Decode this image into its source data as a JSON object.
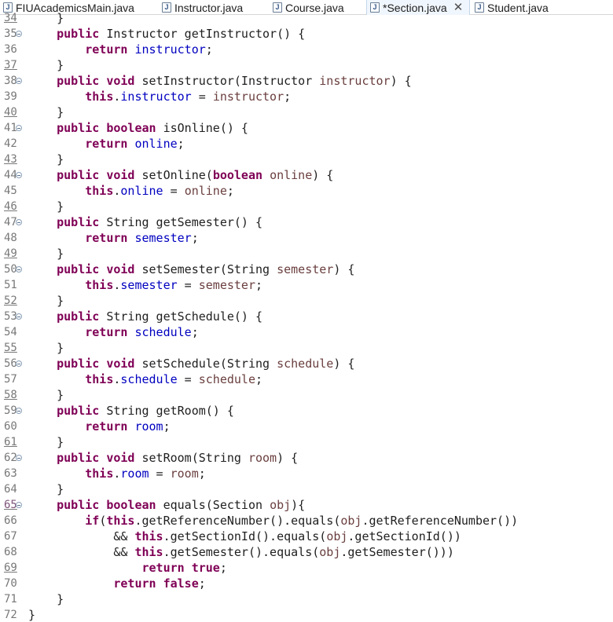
{
  "tabs": [
    {
      "label": "FIUAcademicsMain.java",
      "active": false,
      "closable": false
    },
    {
      "label": "Instructor.java",
      "active": false,
      "closable": false
    },
    {
      "label": "Course.java",
      "active": false,
      "closable": false
    },
    {
      "label": "*Section.java",
      "active": true,
      "closable": true
    },
    {
      "label": "Student.java",
      "active": false,
      "closable": false
    }
  ],
  "tab_close_glyph": "✕",
  "editor_lines": [
    {
      "num": "34",
      "underlined": true,
      "fold": false,
      "segments": [
        [
          "t",
          "    }"
        ]
      ]
    },
    {
      "num": "35",
      "underlined": false,
      "fold": true,
      "segments": [
        [
          "t",
          "    "
        ],
        [
          "k",
          "public"
        ],
        [
          "t",
          " Instructor getInstructor() {"
        ]
      ]
    },
    {
      "num": "36",
      "underlined": false,
      "fold": false,
      "segments": [
        [
          "t",
          "        "
        ],
        [
          "k",
          "return"
        ],
        [
          "t",
          " "
        ],
        [
          "f",
          "instructor"
        ],
        [
          "t",
          ";"
        ]
      ]
    },
    {
      "num": "37",
      "underlined": true,
      "fold": false,
      "segments": [
        [
          "t",
          "    }"
        ]
      ]
    },
    {
      "num": "38",
      "underlined": false,
      "fold": true,
      "segments": [
        [
          "t",
          "    "
        ],
        [
          "k",
          "public"
        ],
        [
          "t",
          " "
        ],
        [
          "k",
          "void"
        ],
        [
          "t",
          " setInstructor(Instructor "
        ],
        [
          "p",
          "instructor"
        ],
        [
          "t",
          ") {"
        ]
      ]
    },
    {
      "num": "39",
      "underlined": false,
      "fold": false,
      "segments": [
        [
          "t",
          "        "
        ],
        [
          "k",
          "this"
        ],
        [
          "t",
          "."
        ],
        [
          "f",
          "instructor"
        ],
        [
          "t",
          " = "
        ],
        [
          "p",
          "instructor"
        ],
        [
          "t",
          ";"
        ]
      ]
    },
    {
      "num": "40",
      "underlined": true,
      "fold": false,
      "segments": [
        [
          "t",
          "    }"
        ]
      ]
    },
    {
      "num": "41",
      "underlined": false,
      "fold": true,
      "segments": [
        [
          "t",
          "    "
        ],
        [
          "k",
          "public"
        ],
        [
          "t",
          " "
        ],
        [
          "k",
          "boolean"
        ],
        [
          "t",
          " isOnline() {"
        ]
      ]
    },
    {
      "num": "42",
      "underlined": false,
      "fold": false,
      "segments": [
        [
          "t",
          "        "
        ],
        [
          "k",
          "return"
        ],
        [
          "t",
          " "
        ],
        [
          "f",
          "online"
        ],
        [
          "t",
          ";"
        ]
      ]
    },
    {
      "num": "43",
      "underlined": true,
      "fold": false,
      "segments": [
        [
          "t",
          "    }"
        ]
      ]
    },
    {
      "num": "44",
      "underlined": false,
      "fold": true,
      "segments": [
        [
          "t",
          "    "
        ],
        [
          "k",
          "public"
        ],
        [
          "t",
          " "
        ],
        [
          "k",
          "void"
        ],
        [
          "t",
          " setOnline("
        ],
        [
          "k",
          "boolean"
        ],
        [
          "t",
          " "
        ],
        [
          "p",
          "online"
        ],
        [
          "t",
          ") {"
        ]
      ]
    },
    {
      "num": "45",
      "underlined": false,
      "fold": false,
      "segments": [
        [
          "t",
          "        "
        ],
        [
          "k",
          "this"
        ],
        [
          "t",
          "."
        ],
        [
          "f",
          "online"
        ],
        [
          "t",
          " = "
        ],
        [
          "p",
          "online"
        ],
        [
          "t",
          ";"
        ]
      ]
    },
    {
      "num": "46",
      "underlined": true,
      "fold": false,
      "segments": [
        [
          "t",
          "    }"
        ]
      ]
    },
    {
      "num": "47",
      "underlined": false,
      "fold": true,
      "segments": [
        [
          "t",
          "    "
        ],
        [
          "k",
          "public"
        ],
        [
          "t",
          " String getSemester() {"
        ]
      ]
    },
    {
      "num": "48",
      "underlined": false,
      "fold": false,
      "segments": [
        [
          "t",
          "        "
        ],
        [
          "k",
          "return"
        ],
        [
          "t",
          " "
        ],
        [
          "f",
          "semester"
        ],
        [
          "t",
          ";"
        ]
      ]
    },
    {
      "num": "49",
      "underlined": true,
      "fold": false,
      "segments": [
        [
          "t",
          "    }"
        ]
      ]
    },
    {
      "num": "50",
      "underlined": false,
      "fold": true,
      "segments": [
        [
          "t",
          "    "
        ],
        [
          "k",
          "public"
        ],
        [
          "t",
          " "
        ],
        [
          "k",
          "void"
        ],
        [
          "t",
          " setSemester(String "
        ],
        [
          "p",
          "semester"
        ],
        [
          "t",
          ") {"
        ]
      ]
    },
    {
      "num": "51",
      "underlined": false,
      "fold": false,
      "segments": [
        [
          "t",
          "        "
        ],
        [
          "k",
          "this"
        ],
        [
          "t",
          "."
        ],
        [
          "f",
          "semester"
        ],
        [
          "t",
          " = "
        ],
        [
          "p",
          "semester"
        ],
        [
          "t",
          ";"
        ]
      ]
    },
    {
      "num": "52",
      "underlined": true,
      "fold": false,
      "segments": [
        [
          "t",
          "    }"
        ]
      ]
    },
    {
      "num": "53",
      "underlined": false,
      "fold": true,
      "segments": [
        [
          "t",
          "    "
        ],
        [
          "k",
          "public"
        ],
        [
          "t",
          " String getSchedule() {"
        ]
      ]
    },
    {
      "num": "54",
      "underlined": false,
      "fold": false,
      "segments": [
        [
          "t",
          "        "
        ],
        [
          "k",
          "return"
        ],
        [
          "t",
          " "
        ],
        [
          "f",
          "schedule"
        ],
        [
          "t",
          ";"
        ]
      ]
    },
    {
      "num": "55",
      "underlined": true,
      "fold": false,
      "segments": [
        [
          "t",
          "    }"
        ]
      ]
    },
    {
      "num": "56",
      "underlined": false,
      "fold": true,
      "segments": [
        [
          "t",
          "    "
        ],
        [
          "k",
          "public"
        ],
        [
          "t",
          " "
        ],
        [
          "k",
          "void"
        ],
        [
          "t",
          " setSchedule(String "
        ],
        [
          "p",
          "schedule"
        ],
        [
          "t",
          ") {"
        ]
      ]
    },
    {
      "num": "57",
      "underlined": false,
      "fold": false,
      "segments": [
        [
          "t",
          "        "
        ],
        [
          "k",
          "this"
        ],
        [
          "t",
          "."
        ],
        [
          "f",
          "schedule"
        ],
        [
          "t",
          " = "
        ],
        [
          "p",
          "schedule"
        ],
        [
          "t",
          ";"
        ]
      ]
    },
    {
      "num": "58",
      "underlined": true,
      "fold": false,
      "segments": [
        [
          "t",
          "    }"
        ]
      ]
    },
    {
      "num": "59",
      "underlined": false,
      "fold": true,
      "segments": [
        [
          "t",
          "    "
        ],
        [
          "k",
          "public"
        ],
        [
          "t",
          " String getRoom() {"
        ]
      ]
    },
    {
      "num": "60",
      "underlined": false,
      "fold": false,
      "segments": [
        [
          "t",
          "        "
        ],
        [
          "k",
          "return"
        ],
        [
          "t",
          " "
        ],
        [
          "f",
          "room"
        ],
        [
          "t",
          ";"
        ]
      ]
    },
    {
      "num": "61",
      "underlined": true,
      "fold": false,
      "segments": [
        [
          "t",
          "    }"
        ]
      ]
    },
    {
      "num": "62",
      "underlined": false,
      "fold": true,
      "segments": [
        [
          "t",
          "    "
        ],
        [
          "k",
          "public"
        ],
        [
          "t",
          " "
        ],
        [
          "k",
          "void"
        ],
        [
          "t",
          " setRoom(String "
        ],
        [
          "p",
          "room"
        ],
        [
          "t",
          ") {"
        ]
      ]
    },
    {
      "num": "63",
      "underlined": false,
      "fold": false,
      "segments": [
        [
          "t",
          "        "
        ],
        [
          "k",
          "this"
        ],
        [
          "t",
          "."
        ],
        [
          "f",
          "room"
        ],
        [
          "t",
          " = "
        ],
        [
          "p",
          "room"
        ],
        [
          "t",
          ";"
        ]
      ]
    },
    {
      "num": "64",
      "underlined": false,
      "fold": false,
      "segments": [
        [
          "t",
          "    }"
        ]
      ]
    },
    {
      "num": "65",
      "underlined": true,
      "fold": true,
      "purple": true,
      "segments": [
        [
          "t",
          "    "
        ],
        [
          "k",
          "public"
        ],
        [
          "t",
          " "
        ],
        [
          "k",
          "boolean"
        ],
        [
          "t",
          " equals(Section "
        ],
        [
          "p",
          "obj"
        ],
        [
          "t",
          "){"
        ]
      ]
    },
    {
      "num": "66",
      "underlined": false,
      "fold": false,
      "segments": [
        [
          "t",
          "        "
        ],
        [
          "k",
          "if"
        ],
        [
          "t",
          "("
        ],
        [
          "k",
          "this"
        ],
        [
          "t",
          ".getReferenceNumber().equals("
        ],
        [
          "p",
          "obj"
        ],
        [
          "t",
          ".getReferenceNumber())"
        ]
      ]
    },
    {
      "num": "67",
      "underlined": false,
      "fold": false,
      "segments": [
        [
          "t",
          "            && "
        ],
        [
          "k",
          "this"
        ],
        [
          "t",
          ".getSectionId().equals("
        ],
        [
          "p",
          "obj"
        ],
        [
          "t",
          ".getSectionId())"
        ]
      ]
    },
    {
      "num": "68",
      "underlined": false,
      "fold": false,
      "segments": [
        [
          "t",
          "            && "
        ],
        [
          "k",
          "this"
        ],
        [
          "t",
          ".getSemester().equals("
        ],
        [
          "p",
          "obj"
        ],
        [
          "t",
          ".getSemester()))"
        ]
      ]
    },
    {
      "num": "69",
      "underlined": true,
      "fold": false,
      "segments": [
        [
          "t",
          "                "
        ],
        [
          "k",
          "return"
        ],
        [
          "t",
          " "
        ],
        [
          "k",
          "true"
        ],
        [
          "t",
          ";"
        ]
      ]
    },
    {
      "num": "70",
      "underlined": false,
      "fold": false,
      "segments": [
        [
          "t",
          "            "
        ],
        [
          "k",
          "return"
        ],
        [
          "t",
          " "
        ],
        [
          "k",
          "false"
        ],
        [
          "t",
          ";"
        ]
      ]
    },
    {
      "num": "71",
      "underlined": false,
      "fold": false,
      "segments": [
        [
          "t",
          "    }"
        ]
      ]
    },
    {
      "num": "72",
      "underlined": false,
      "fold": false,
      "segments": [
        [
          "t",
          "}"
        ]
      ]
    }
  ],
  "colors": {
    "keyword": "#7f0055",
    "field": "#0000c0",
    "parameter": "#6a3e3e",
    "line_number": "#787878",
    "active_tab_bg": "#f0f6fd"
  }
}
